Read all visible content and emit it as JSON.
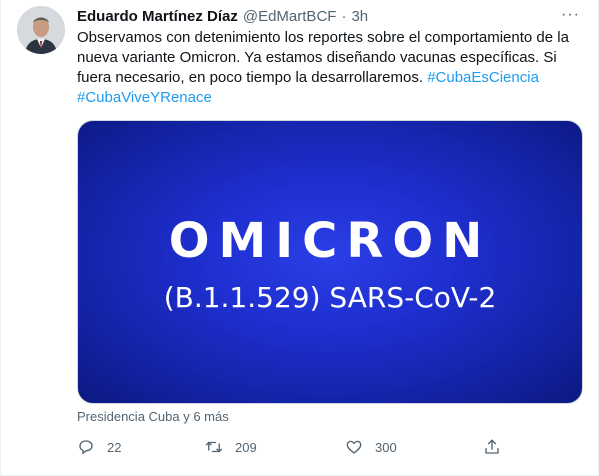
{
  "tweet": {
    "author_name": "Eduardo Martínez Díaz",
    "handle": "@EdMartBCF",
    "separator": "·",
    "time": "3h",
    "more_label": "···",
    "text_lines": [
      "Observamos con detenimiento los reportes sobre el comportamiento de la",
      "nueva variante Omicron. Ya estamos diseñando vacunas específicas. Si",
      "fuera necesario, en poco tiempo la desarrollaremos. "
    ],
    "hashtags": [
      "#CubaEsCiencia",
      "#CubaViveYRenace"
    ],
    "media": {
      "title": "OMICRON",
      "subtitle": "(B.1.1.529) SARS-CoV-2",
      "background_color": "#1f2fd0"
    },
    "source_line": "Presidencia Cuba y 6 más",
    "actions": {
      "reply_count": "22",
      "retweet_count": "209",
      "like_count": "300"
    }
  },
  "icons": [
    "reply-icon",
    "retweet-icon",
    "like-icon",
    "share-icon",
    "more-icon"
  ],
  "colors": {
    "link": "#1d9bf0",
    "muted": "#536471",
    "text": "#0f1419"
  }
}
